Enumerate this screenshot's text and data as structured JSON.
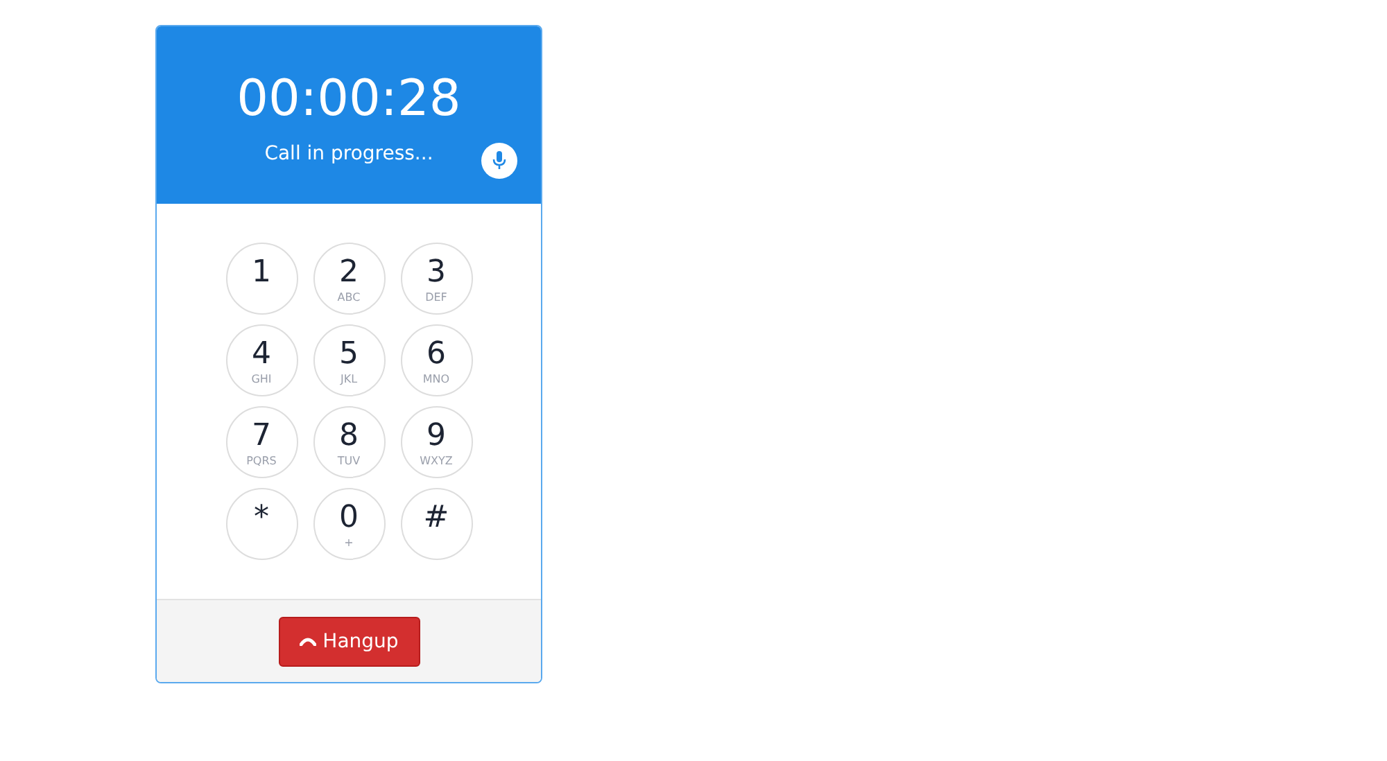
{
  "timer": "00:00:28",
  "status": "Call in progress...",
  "keys": [
    {
      "digit": "1"
    },
    {
      "digit": "2",
      "letters": "ABC"
    },
    {
      "digit": "3",
      "letters": "DEF"
    },
    {
      "digit": "4",
      "letters": "GHI"
    },
    {
      "digit": "5",
      "letters": "JKL"
    },
    {
      "digit": "6",
      "letters": "MNO"
    },
    {
      "digit": "7",
      "letters": "PQRS"
    },
    {
      "digit": "8",
      "letters": "TUV"
    },
    {
      "digit": "9",
      "letters": "WXYZ"
    },
    {
      "digit": "*"
    },
    {
      "digit": "0",
      "letters": "+"
    },
    {
      "digit": "#"
    }
  ],
  "hangup_button": "Hangup"
}
